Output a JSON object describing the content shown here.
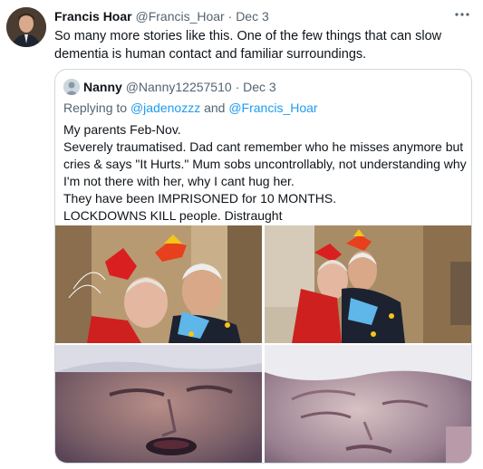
{
  "tweet": {
    "author_name": "Francis Hoar",
    "author_handle": "@Francis_Hoar",
    "separator": "·",
    "date": "Dec 3",
    "more_icon": "more-horizontal-icon",
    "text": "So many more stories like this.  One of the few things that can slow dementia is human contact and familiar surroundings."
  },
  "quoted": {
    "author_name": "Nanny",
    "author_handle": "@Nanny12257510",
    "separator": "·",
    "date": "Dec 3",
    "reply_prefix": "Replying to",
    "reply_user1": "@jadenozzz",
    "reply_and": "and",
    "reply_user2": "@Francis_Hoar",
    "lines": [
      "My parents Feb-Nov.",
      "Severely traumatised. Dad cant remember who he misses anymore but",
      "cries & says \"It Hurts.\" Mum sobs uncontrollably, not understanding why",
      "I'm not there with her, why I cant hug her.",
      "They have been IMPRISONED for 10 MONTHS.",
      "LOCKDOWNS KILL people. Distraught"
    ]
  },
  "colors": {
    "link": "#1d9bf0",
    "muted": "#536471",
    "border": "#cfd9de"
  }
}
